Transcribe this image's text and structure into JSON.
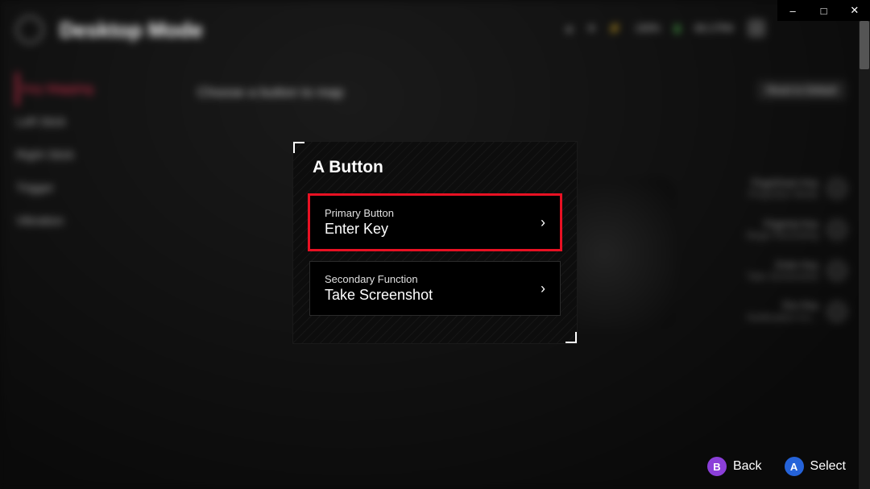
{
  "window": {
    "minimize": "–",
    "maximize": "□",
    "close": "✕"
  },
  "header": {
    "title": "Desktop Mode"
  },
  "status": {
    "battery": "100%",
    "time": "06:17PM"
  },
  "sidebar": {
    "items": [
      {
        "label": "Key Mapping"
      },
      {
        "label": "Left Stick"
      },
      {
        "label": "Right Stick"
      },
      {
        "label": "Trigger"
      },
      {
        "label": "Vibration"
      }
    ]
  },
  "subtitle": "Choose a button to map",
  "reset_label": "Reset to Default",
  "modal": {
    "title": "A Button",
    "options": [
      {
        "label": "Primary Button",
        "value": "Enter Key"
      },
      {
        "label": "Secondary Function",
        "value": "Take Screenshot"
      }
    ]
  },
  "rightpanel": [
    {
      "title": "PageDown Key",
      "sub": "Projection Mode"
    },
    {
      "title": "PageUp Key",
      "sub": "Begin Recording"
    },
    {
      "title": "Enter Key",
      "sub": "Take Screenshot"
    },
    {
      "title": "Esc Key",
      "sub": "Notification-Ce..."
    }
  ],
  "footer": {
    "back": {
      "glyph": "B",
      "label": "Back"
    },
    "select": {
      "glyph": "A",
      "label": "Select"
    }
  }
}
